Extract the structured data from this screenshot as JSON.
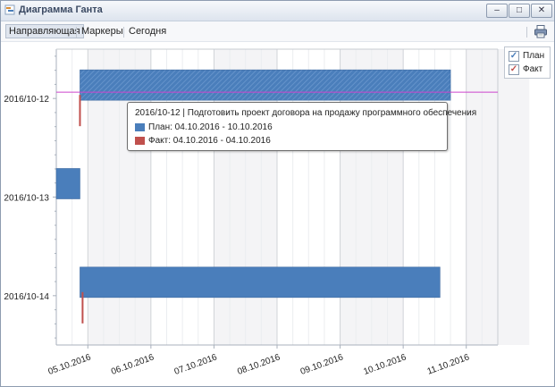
{
  "window": {
    "title": "Диаграмма Ганта",
    "minimize_label": "–",
    "maximize_label": "□",
    "close_label": "✕"
  },
  "toolbar": {
    "items": [
      "Направляющая",
      "Маркеры",
      "Сегодня"
    ],
    "print_icon": "printer-icon"
  },
  "legend": {
    "items": [
      {
        "label": "План",
        "checked": true,
        "color": "#4a7ebb"
      },
      {
        "label": "Факт",
        "checked": true,
        "color": "#c0504d"
      }
    ]
  },
  "colors": {
    "plan": "#4a7ebb",
    "fact": "#c0504d",
    "guide_line": "#cc44cc"
  },
  "tooltip": {
    "title": "2016/10-12 | Подготовить проект договора на продажу программного обеспечения",
    "plan_text": "План: 04.10.2016 - 10.10.2016",
    "fact_text": "Факт: 04.10.2016 - 04.10.2016"
  },
  "chart_data": {
    "type": "gantt",
    "tasks": [
      "2016/10-12",
      "2016/10-13",
      "2016/10-14"
    ],
    "x_tick_labels": [
      "05.10.2016",
      "06.10.2016",
      "07.10.2016",
      "08.10.2016",
      "09.10.2016",
      "10.10.2016",
      "11.10.2016"
    ],
    "x_range": [
      "2016-10-04 12:00",
      "2016-10-11 12:00"
    ],
    "plan": [
      {
        "task": "2016/10-12",
        "start": "2016-10-04 21:00",
        "end": "2016-10-10 18:00",
        "hatched": true
      },
      {
        "task": "2016/10-13",
        "start": "2016-10-04 12:00",
        "end": "2016-10-04 21:00",
        "hatched": false
      },
      {
        "task": "2016/10-14",
        "start": "2016-10-04 21:00",
        "end": "2016-10-10 14:00",
        "hatched": false
      }
    ],
    "fact": [
      {
        "task": "2016/10-12",
        "start": "2016-10-04 21:00",
        "end": "2016-10-04 21:00"
      },
      {
        "task": "2016/10-14",
        "start": "2016-10-04 22:00",
        "end": "2016-10-04 22:00"
      }
    ],
    "guide_line_task": "2016/10-12",
    "grid": true
  }
}
